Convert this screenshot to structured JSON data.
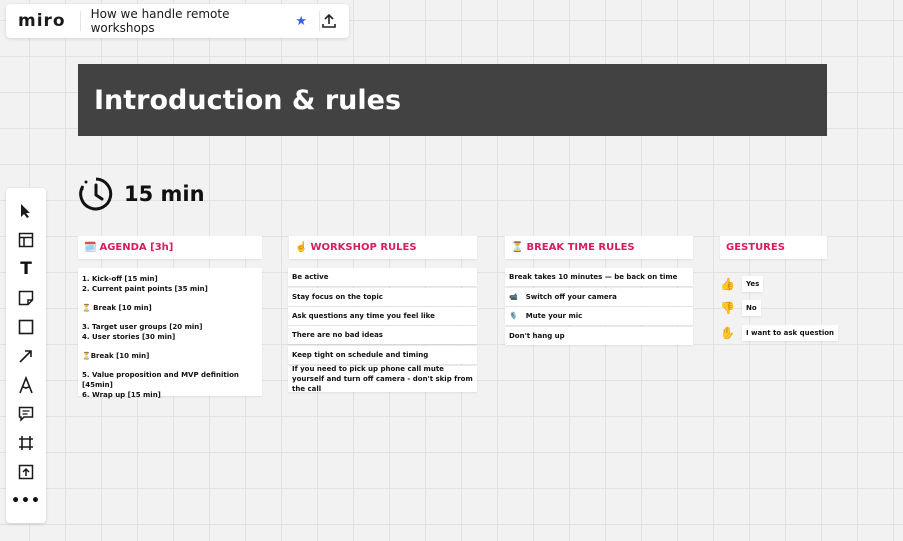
{
  "app": {
    "logo": "miro",
    "board_title": "How we handle remote workshops"
  },
  "banner": {
    "title": "Introduction & rules"
  },
  "timer": {
    "label": "15 min"
  },
  "toolbar": {
    "tools": [
      "select-cursor-icon",
      "templates-icon",
      "text-icon",
      "sticky-note-icon",
      "shape-icon",
      "arrow-icon",
      "pen-icon",
      "comment-icon",
      "frame-icon",
      "upload-icon",
      "more-icon"
    ]
  },
  "columns": {
    "agenda": {
      "emoji": "🗓️",
      "title": "AGENDA [3h]"
    },
    "workshop": {
      "emoji": "☝️",
      "title": "WORKSHOP RULES"
    },
    "break": {
      "emoji": "⏳",
      "title": "BREAK TIME RULES"
    },
    "gestures": {
      "emoji": "",
      "title": "GESTURES"
    }
  },
  "agenda": {
    "l1": "1. Kick-off [15 min]",
    "l2": "2. Current paint points [35 min]",
    "l3": "⏳ Break [10 min]",
    "l4": "3. Target user groups [20 min]",
    "l5": "4. User stories [30 min]",
    "l6": "⏳Break [10 min]",
    "l7": "5. Value proposition and MVP definition [45min]",
    "l8": "6. Wrap up [15 min]"
  },
  "workshop_rules": [
    "Be active",
    "Stay focus on the topic",
    "Ask questions any time you feel like",
    "There are no bad ideas",
    "Keep tight on schedule and timing",
    "If you need to pick up phone call mute yourself and turn off camera - don't skip from the call"
  ],
  "break_rules": [
    {
      "emoji": "",
      "text": "Break takes 10 minutes — be back on time"
    },
    {
      "emoji": "📹",
      "text": "Switch off your camera"
    },
    {
      "emoji": "🎙️",
      "text": "Mute your mic"
    },
    {
      "emoji": "",
      "text": "Don't hang up"
    }
  ],
  "gestures": [
    {
      "emoji": "👍",
      "text": "Yes"
    },
    {
      "emoji": "👎",
      "text": "No"
    },
    {
      "emoji": "✋",
      "text": "I want to ask question"
    }
  ],
  "colors": {
    "accent": "#d81b60",
    "banner": "#424242",
    "star": "#3b5cf0"
  }
}
